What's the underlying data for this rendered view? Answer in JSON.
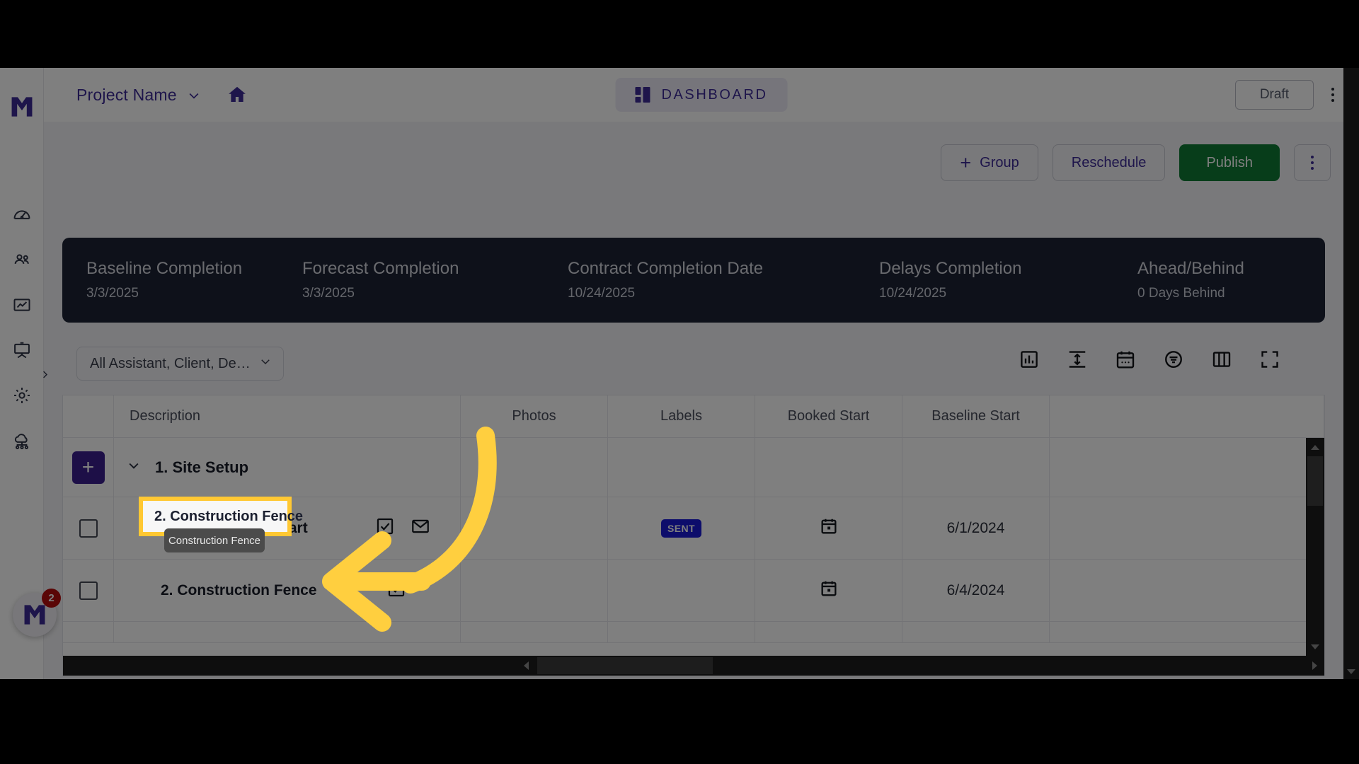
{
  "app": {
    "brand_color": "#3d2b96",
    "logo_name": "mastt-logo"
  },
  "sidebar": {
    "items": [
      {
        "icon": "speedometer-icon",
        "label": "Dashboard"
      },
      {
        "icon": "people-icon",
        "label": "Team"
      },
      {
        "icon": "analytics-chart-icon",
        "label": "Reports"
      },
      {
        "icon": "presentation-board-icon",
        "label": "Presentations"
      },
      {
        "icon": "gear-icon",
        "label": "Settings"
      },
      {
        "icon": "cloud-network-icon",
        "label": "Integrations"
      }
    ],
    "expand_icon": "chevron-right-icon"
  },
  "topbar": {
    "project_name": "Project Name",
    "project_chevron": "chevron-down-icon",
    "home_icon": "home-icon",
    "page_title": "DASHBOARD",
    "page_title_icon": "dashboard-tiles-icon",
    "status_label": "Draft",
    "overflow_icon": "kebab-menu-icon"
  },
  "actions": {
    "group_label": "Group",
    "group_plus": "+",
    "reschedule_label": "Reschedule",
    "publish_label": "Publish",
    "publish_color": "#0e7a34",
    "more_icon": "kebab-menu-icon"
  },
  "summary": {
    "background": "#1c2235",
    "cells": [
      {
        "title": "Baseline Completion",
        "value": "3/3/2025"
      },
      {
        "title": "Forecast Completion",
        "value": "3/3/2025"
      },
      {
        "title": "Contract Completion Date",
        "value": "10/24/2025"
      },
      {
        "title": "Delays Completion",
        "value": "10/24/2025"
      },
      {
        "title": "Ahead/Behind",
        "value": "0 Days Behind"
      }
    ]
  },
  "filter": {
    "entity_filter_value": "All Assistant, Client, De…",
    "entity_filter_chevron": "chevron-down-icon",
    "tools": [
      {
        "icon": "bar-chart-icon",
        "label": "Charts"
      },
      {
        "icon": "row-height-icon",
        "label": "Row height"
      },
      {
        "icon": "calendar-icon",
        "label": "Calendar"
      },
      {
        "icon": "filter-icon",
        "label": "Filter"
      },
      {
        "icon": "columns-icon",
        "label": "Columns"
      },
      {
        "icon": "fullscreen-icon",
        "label": "Fullscreen"
      }
    ]
  },
  "table": {
    "columns": [
      "",
      "Description",
      "Photos",
      "Labels",
      "Booked Start",
      "Baseline Start"
    ],
    "add_row_label": "+",
    "group": {
      "collapse_icon": "chevron-down-icon",
      "name": "1. Site Setup"
    },
    "rows": [
      {
        "checkbox": false,
        "description": "1. Construction Start",
        "desc_icons": [
          "checkbox-checked-icon",
          "envelope-icon"
        ],
        "photos": "",
        "label_badge": "SENT",
        "booked_start_icon": "calendar-icon",
        "booked_start": "",
        "baseline_start": "6/1/2024"
      },
      {
        "checkbox": false,
        "description": "2. Construction Fence",
        "desc_icons": [
          "checkbox-checked-icon"
        ],
        "photos": "",
        "label_badge": "",
        "booked_start_icon": "calendar-icon",
        "booked_start": "",
        "baseline_start": "6/4/2024"
      }
    ]
  },
  "annotation": {
    "highlight_text": "2. Construction Fence",
    "highlight_color": "#FFC833",
    "tooltip_text": "Construction Fence",
    "arrow_color": "#FFCF3F",
    "arrow_name": "curved-arrow-pointing-left"
  },
  "chat": {
    "launcher_icon": "mastt-logo",
    "unread_count": "2"
  },
  "scrollbars": {
    "grid_vertical": "grid-vertical-scrollbar",
    "grid_horizontal": "grid-horizontal-scrollbar",
    "page_vertical": "page-vertical-scrollbar"
  }
}
